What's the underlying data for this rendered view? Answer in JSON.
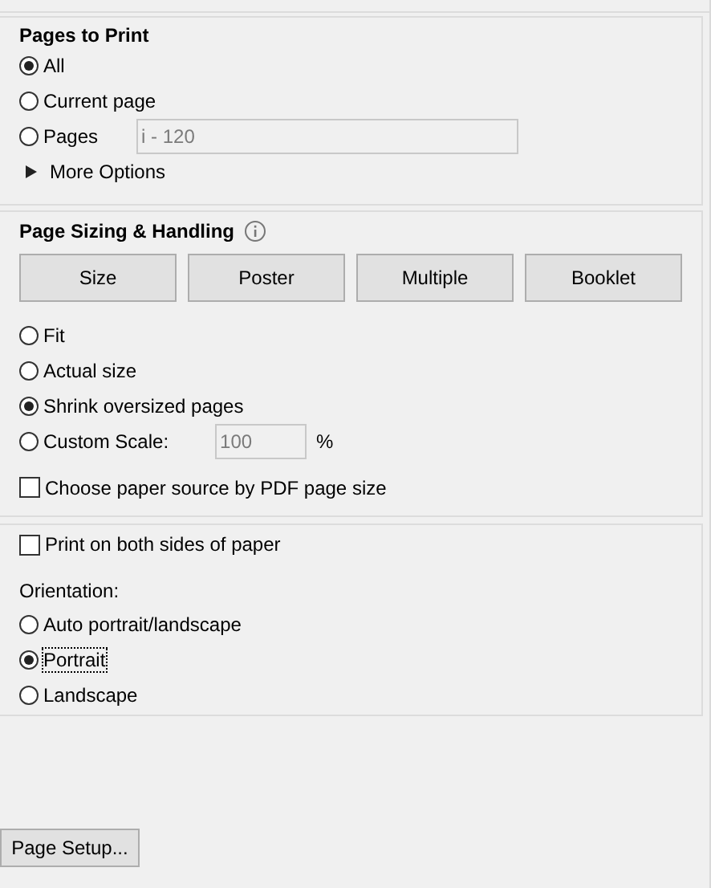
{
  "pages_to_print": {
    "title": "Pages to Print",
    "options": [
      {
        "label": "All",
        "selected": true
      },
      {
        "label": "Current page",
        "selected": false
      },
      {
        "label": "Pages",
        "selected": false,
        "field": {
          "value": "i - 120",
          "disabled": true
        }
      }
    ],
    "more_options": {
      "label": "More Options",
      "expanded": false
    }
  },
  "page_sizing": {
    "title": "Page Sizing & Handling",
    "buttons": [
      {
        "label": "Size"
      },
      {
        "label": "Poster"
      },
      {
        "label": "Multiple"
      },
      {
        "label": "Booklet"
      }
    ],
    "options": [
      {
        "label": "Fit",
        "selected": false
      },
      {
        "label": "Actual size",
        "selected": false
      },
      {
        "label": "Shrink oversized pages",
        "selected": true
      },
      {
        "label": "Custom Scale:",
        "selected": false,
        "field": {
          "value": "100",
          "disabled": true
        },
        "suffix": "%"
      }
    ],
    "paper_source": {
      "label": "Choose paper source by PDF page size",
      "checked": false
    }
  },
  "duplex": {
    "label": "Print on both sides of paper",
    "checked": false
  },
  "orientation": {
    "title": "Orientation:",
    "options": [
      {
        "label": "Auto portrait/landscape",
        "selected": false,
        "focused": false
      },
      {
        "label": "Portrait",
        "selected": true,
        "focused": true
      },
      {
        "label": "Landscape",
        "selected": false,
        "focused": false
      }
    ]
  },
  "page_setup_button": {
    "label": "Page Setup..."
  }
}
